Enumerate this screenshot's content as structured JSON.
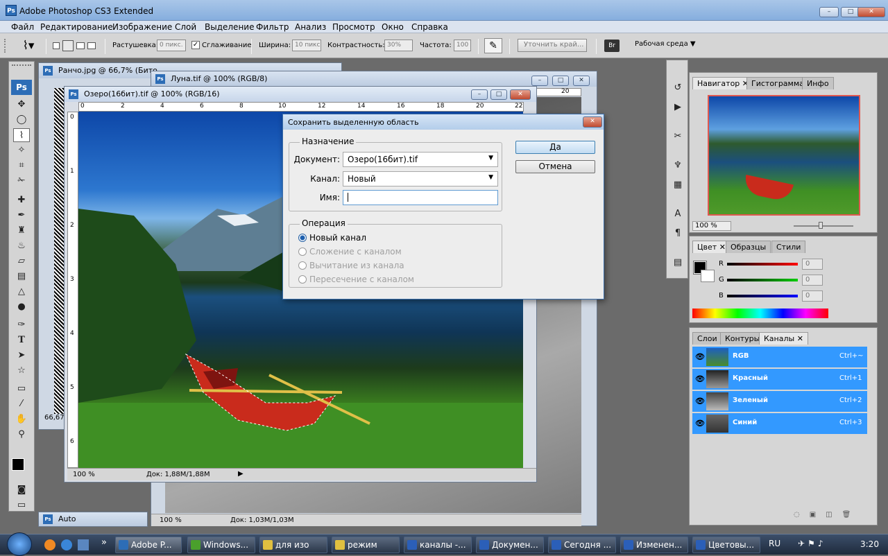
{
  "app": {
    "title": "Adobe Photoshop CS3 Extended",
    "logo": "Ps"
  },
  "window_controls": {
    "minimize": "–",
    "maximize": "□",
    "close": "✕"
  },
  "menu": [
    "Файл",
    "Редактирование",
    "Изображение",
    "Слой",
    "Выделение",
    "Фильтр",
    "Анализ",
    "Просмотр",
    "Окно",
    "Справка"
  ],
  "options": {
    "feather_label": "Растушевка:",
    "feather_value": "0 пикс.",
    "antialias_label": "Сглаживание",
    "antialias_checked": true,
    "width_label": "Ширина:",
    "width_value": "10 пикс",
    "contrast_label": "Контрастность:",
    "contrast_value": "30%",
    "frequency_label": "Частота:",
    "frequency_value": "100",
    "refine_edge": "Уточнить край...",
    "workspace": "Рабочая среда"
  },
  "documents": {
    "rancho": {
      "title": "Ранчо.jpg @ 66,7% (Бито",
      "zoom": "66,67"
    },
    "luna": {
      "title": "Луна.tif @ 100% (RGB/8)",
      "zoom": "100 %",
      "doc_info": "Док: 1,03M/1,03M"
    },
    "ozero": {
      "title": "Озеро(16бит).tif @ 100% (RGB/16)",
      "zoom": "100 %",
      "doc_info": "Док: 1,88M/1,88M"
    },
    "auto": {
      "title": "Auto"
    }
  },
  "ruler": {
    "top_ozero": [
      "0",
      "2",
      "4",
      "6",
      "8",
      "10",
      "12",
      "14",
      "16",
      "18",
      "20",
      "22"
    ],
    "top_luna": [
      "20"
    ],
    "left_ozero": [
      "0",
      "1",
      "2",
      "3",
      "4",
      "5",
      "6"
    ]
  },
  "dialog": {
    "title": "Сохранить выделенную область",
    "destination_group": "Назначение",
    "document_label": "Документ:",
    "document_value": "Озеро(16бит).tif",
    "channel_label": "Канал:",
    "channel_value": "Новый",
    "name_label": "Имя:",
    "name_value": "",
    "operation_group": "Операция",
    "operations": [
      {
        "label": "Новый канал",
        "checked": true,
        "enabled": true
      },
      {
        "label": "Сложение с каналом",
        "checked": false,
        "enabled": false
      },
      {
        "label": "Вычитание из канала",
        "checked": false,
        "enabled": false
      },
      {
        "label": "Пересечение с каналом",
        "checked": false,
        "enabled": false
      }
    ],
    "ok": "Да",
    "cancel": "Отмена"
  },
  "navigator_panel": {
    "tabs": [
      "Навигатор",
      "Гистограмма",
      "Инфо"
    ],
    "zoom": "100 %"
  },
  "color_panel": {
    "tabs": [
      "Цвет",
      "Образцы",
      "Стили"
    ],
    "sliders": [
      {
        "label": "R",
        "value": "0",
        "color": "#d00000"
      },
      {
        "label": "G",
        "value": "0",
        "color": "#00a000"
      },
      {
        "label": "B",
        "value": "0",
        "color": "#0000d0"
      }
    ]
  },
  "layers_panel": {
    "tabs": [
      "Слои",
      "Контуры",
      "Каналы"
    ],
    "channels": [
      {
        "name": "RGB",
        "shortcut": "Ctrl+~"
      },
      {
        "name": "Красный",
        "shortcut": "Ctrl+1"
      },
      {
        "name": "Зеленый",
        "shortcut": "Ctrl+2"
      },
      {
        "name": "Синий",
        "shortcut": "Ctrl+3"
      }
    ]
  },
  "taskbar": {
    "tasks": [
      {
        "label": "Adobe P...",
        "color": "#2d6db6"
      },
      {
        "label": "Windows...",
        "color": "#4aa02c"
      },
      {
        "label": "для изо",
        "color": "#e0c040"
      },
      {
        "label": "режим",
        "color": "#e0c040"
      },
      {
        "label": "каналы -...",
        "color": "#2b5fb8"
      },
      {
        "label": "Докумен...",
        "color": "#2b5fb8"
      },
      {
        "label": "Сегодня ...",
        "color": "#2b5fb8"
      },
      {
        "label": "Изменен...",
        "color": "#2b5fb8"
      },
      {
        "label": "Цветовы...",
        "color": "#2b5fb8"
      }
    ],
    "lang": "RU",
    "time": "3:20"
  },
  "colors": {
    "accent": "#3399ff",
    "titlebar": "#9dbde4",
    "canvas_bg": "#6b6b6b"
  }
}
